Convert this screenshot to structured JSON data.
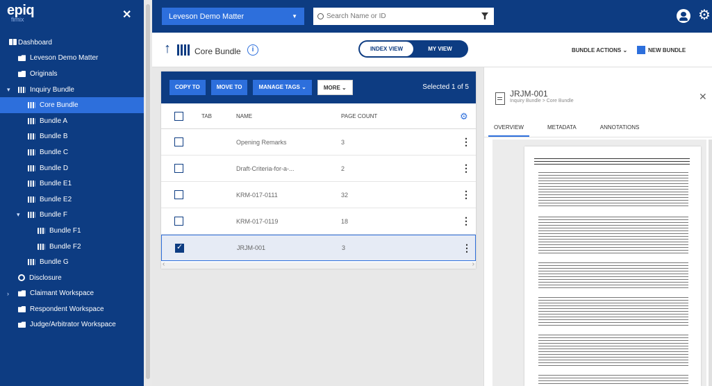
{
  "sidebar": {
    "logo": "epiq",
    "logo_sub": "fimix",
    "close": "✕",
    "items": [
      {
        "label": "Dashboard",
        "indent": 0,
        "icon": "grid",
        "caret": ""
      },
      {
        "label": "Leveson Demo Matter",
        "indent": 0,
        "icon": "folder",
        "caret": ""
      },
      {
        "label": "Originals",
        "indent": 0,
        "icon": "folder",
        "caret": ""
      },
      {
        "label": "Inquiry Bundle",
        "indent": 0,
        "icon": "book",
        "caret": "▾"
      },
      {
        "label": "Core Bundle",
        "indent": 1,
        "icon": "book",
        "caret": "",
        "active": true
      },
      {
        "label": "Bundle A",
        "indent": 1,
        "icon": "book",
        "caret": ""
      },
      {
        "label": "Bundle B",
        "indent": 1,
        "icon": "book",
        "caret": ""
      },
      {
        "label": "Bundle C",
        "indent": 1,
        "icon": "book",
        "caret": ""
      },
      {
        "label": "Bundle D",
        "indent": 1,
        "icon": "book",
        "caret": ""
      },
      {
        "label": "Bundle E1",
        "indent": 1,
        "icon": "book",
        "caret": ""
      },
      {
        "label": "Bundle E2",
        "indent": 1,
        "icon": "book",
        "caret": ""
      },
      {
        "label": "Bundle F",
        "indent": 1,
        "icon": "book",
        "caret": "▾"
      },
      {
        "label": "Bundle F1",
        "indent": 2,
        "icon": "book",
        "caret": ""
      },
      {
        "label": "Bundle F2",
        "indent": 2,
        "icon": "book",
        "caret": ""
      },
      {
        "label": "Bundle G",
        "indent": 1,
        "icon": "book",
        "caret": ""
      },
      {
        "label": "Disclosure",
        "indent": 0,
        "icon": "globe",
        "caret": ""
      },
      {
        "label": "Claimant Workspace",
        "indent": 0,
        "icon": "folder",
        "caret": "›"
      },
      {
        "label": "Respondent Workspace",
        "indent": 0,
        "icon": "folder",
        "caret": ""
      },
      {
        "label": "Judge/Arbitrator Workspace",
        "indent": 0,
        "icon": "folder",
        "caret": ""
      }
    ]
  },
  "topbar": {
    "matter": "Leveson Demo Matter",
    "matter_caret": "▼",
    "search_placeholder": "Search Name or ID"
  },
  "subheader": {
    "back": "↑",
    "title": "Core Bundle",
    "info": "i",
    "index_view": "INDEX VIEW",
    "my_view": "MY VIEW",
    "bundle_actions": "BUNDLE ACTIONS  ⌄",
    "new_bundle": "NEW BUNDLE"
  },
  "grid": {
    "toolbar": {
      "copy_to": "COPY TO",
      "move_to": "MOVE TO",
      "manage_tags": "MANAGE TAGS ⌄",
      "more": "MORE ⌄",
      "selected": "Selected 1 of 5"
    },
    "headers": {
      "tab": "TAB",
      "name": "NAME",
      "page_count": "PAGE COUNT"
    },
    "rows": [
      {
        "name": "Opening Remarks",
        "page_count": "3",
        "checked": false
      },
      {
        "name": "Draft-Criteria-for-a-...",
        "page_count": "2",
        "checked": false
      },
      {
        "name": "KRM-017-0111",
        "page_count": "32",
        "checked": false
      },
      {
        "name": "KRM-017-0119",
        "page_count": "18",
        "checked": false
      },
      {
        "name": "JRJM-001",
        "page_count": "3",
        "checked": true
      }
    ]
  },
  "doc_panel": {
    "title": "JRJM-001",
    "path": "Inquiry Bundle > Core Bundle",
    "close": "✕",
    "tabs": [
      "OVERVIEW",
      "METADATA",
      "ANNOTATIONS"
    ],
    "active_tab": 0
  },
  "colors": {
    "navy": "#0d3c82",
    "accent": "#2d6fdc"
  }
}
